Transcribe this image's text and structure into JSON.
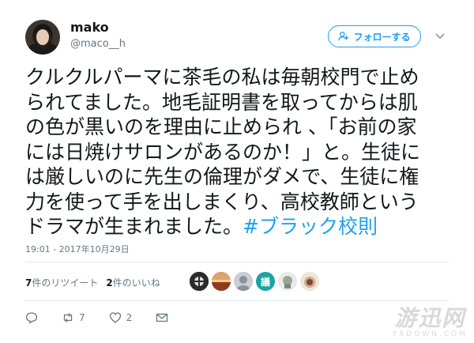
{
  "user": {
    "display_name": "mako",
    "handle": "@maco__h"
  },
  "follow_button": {
    "label": "フォローする",
    "icon": "add-user-icon"
  },
  "menu": {
    "icon": "chevron-down-icon"
  },
  "tweet": {
    "lines": [
      "クルクルパーマに茶毛の私は毎朝校門で止め",
      "られてました。地毛証明書を取ってからは肌",
      "の色が黒いのを理由に止められ 、「お前の家",
      "には日焼けサロンがあるのか！」と。生徒に",
      "は厳しいのに先生の倫理がダメで、生徒に権",
      "力を使って手を出しまくり、高校教師という",
      "ドラマが生まれました。"
    ],
    "hashtag": "#ブラック校則",
    "timestamp": "19:01 - 2017年10月29日"
  },
  "stats": {
    "retweet_count": "7",
    "retweet_label": "件のリツイート",
    "like_count": "2",
    "like_label": "件のいいね"
  },
  "likers": [
    {
      "name": "liker-avatar-1",
      "color": "#2b2b2b"
    },
    {
      "name": "liker-avatar-2",
      "color": "#c05a32"
    },
    {
      "name": "liker-avatar-3",
      "color": "#b6bcc2"
    },
    {
      "name": "liker-avatar-4",
      "color": "#1aa3a3",
      "glyph": "議"
    },
    {
      "name": "liker-avatar-5",
      "color": "#9aa69a"
    },
    {
      "name": "liker-avatar-6",
      "color": "#cfa98a"
    }
  ],
  "actions": {
    "reply": {
      "icon": "reply-icon",
      "count": ""
    },
    "retweet": {
      "icon": "retweet-icon",
      "count": "7"
    },
    "like": {
      "icon": "heart-icon",
      "count": "2"
    },
    "dm": {
      "icon": "mail-icon"
    }
  },
  "watermark": {
    "main": "游迅网",
    "sub": "YXDOWN.COM"
  },
  "colors": {
    "accent": "#1da1f2",
    "text": "#14171a",
    "muted": "#657786",
    "divider": "#e1e8ed"
  }
}
